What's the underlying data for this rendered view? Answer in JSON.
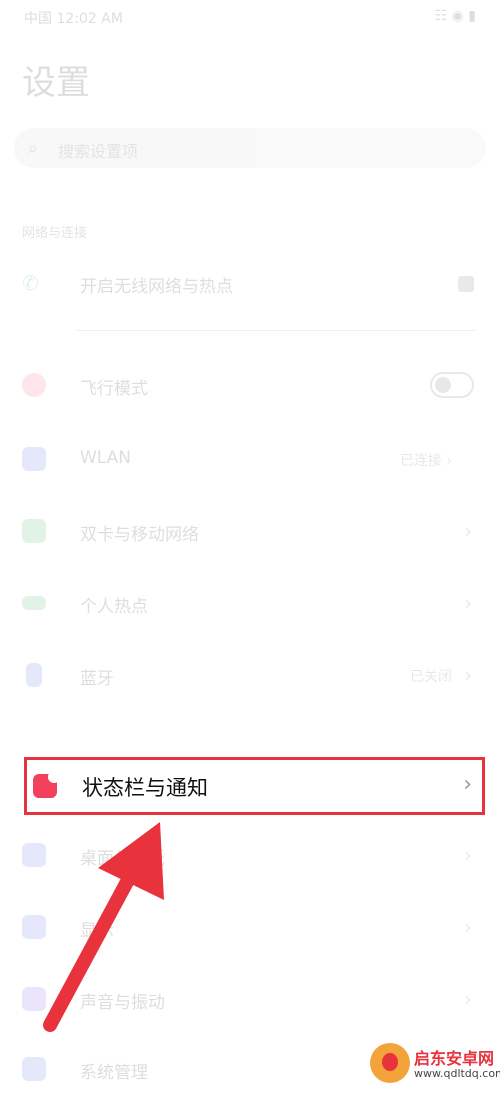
{
  "status_bar": {
    "carrier": "中国 12:02 AM",
    "battery": "☷ ◉ ▮"
  },
  "page_title": "设置",
  "search": {
    "placeholder": "搜索设置项"
  },
  "section_label": "网络与连接",
  "rows": [
    {
      "label": "开启无线网络与热点",
      "value": ""
    },
    {
      "label": "飞行模式",
      "value": ""
    },
    {
      "label": "WLAN",
      "value": "已连接 ›"
    },
    {
      "label": "双卡与移动网络",
      "value": ""
    },
    {
      "label": "个人热点",
      "value": ""
    },
    {
      "label": "蓝牙",
      "value": "已关闭"
    }
  ],
  "highlight_row": {
    "label": "状态栏与通知"
  },
  "rows_below": [
    {
      "label": "桌面与壁纸"
    },
    {
      "label": "显示"
    },
    {
      "label": "声音与振动"
    },
    {
      "label": "系统管理"
    }
  ],
  "chevron": "›",
  "watermark": {
    "title": "启东安卓网",
    "url": "www.qdltdq.com"
  },
  "colors": {
    "highlight_border": "#e8323c",
    "status_icon": "#f2405c",
    "arrow": "#e8323c"
  }
}
